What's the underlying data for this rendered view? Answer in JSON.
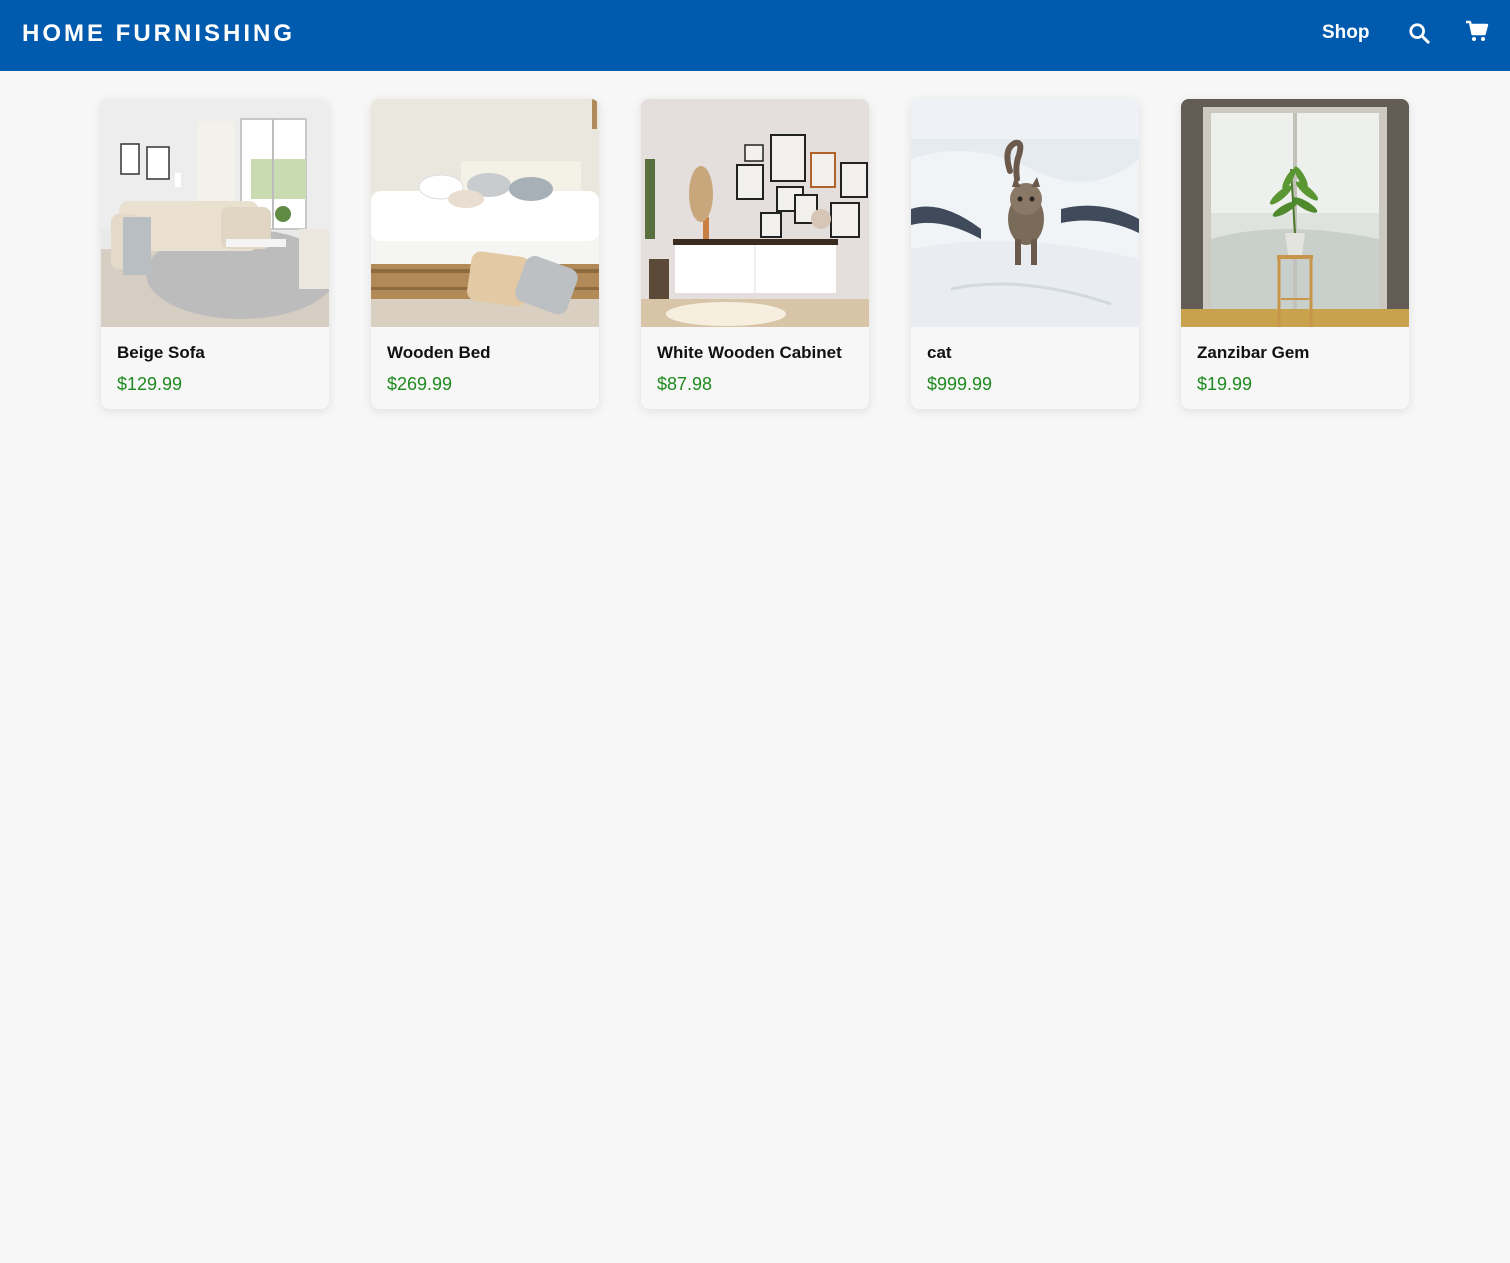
{
  "header": {
    "brand": "HOME FURNISHING",
    "nav_shop": "Shop",
    "search_icon": "search-icon",
    "cart_icon": "cart-icon",
    "background_color": "#005aad"
  },
  "products": [
    {
      "name": "Beige Sofa",
      "price": "$129.99",
      "image": "living-room-beige-sofa"
    },
    {
      "name": "Wooden Bed",
      "price": "$269.99",
      "image": "bedroom-wooden-bed"
    },
    {
      "name": "White Wooden Cabinet",
      "price": "$87.98",
      "image": "white-cabinet-gallery-wall"
    },
    {
      "name": "cat",
      "price": "$999.99",
      "image": "kitten-on-bed"
    },
    {
      "name": "Zanzibar Gem",
      "price": "$19.99",
      "image": "potted-plant-by-window"
    }
  ],
  "colors": {
    "price": "#1e8a1e",
    "page_background": "#f7f7f7"
  }
}
